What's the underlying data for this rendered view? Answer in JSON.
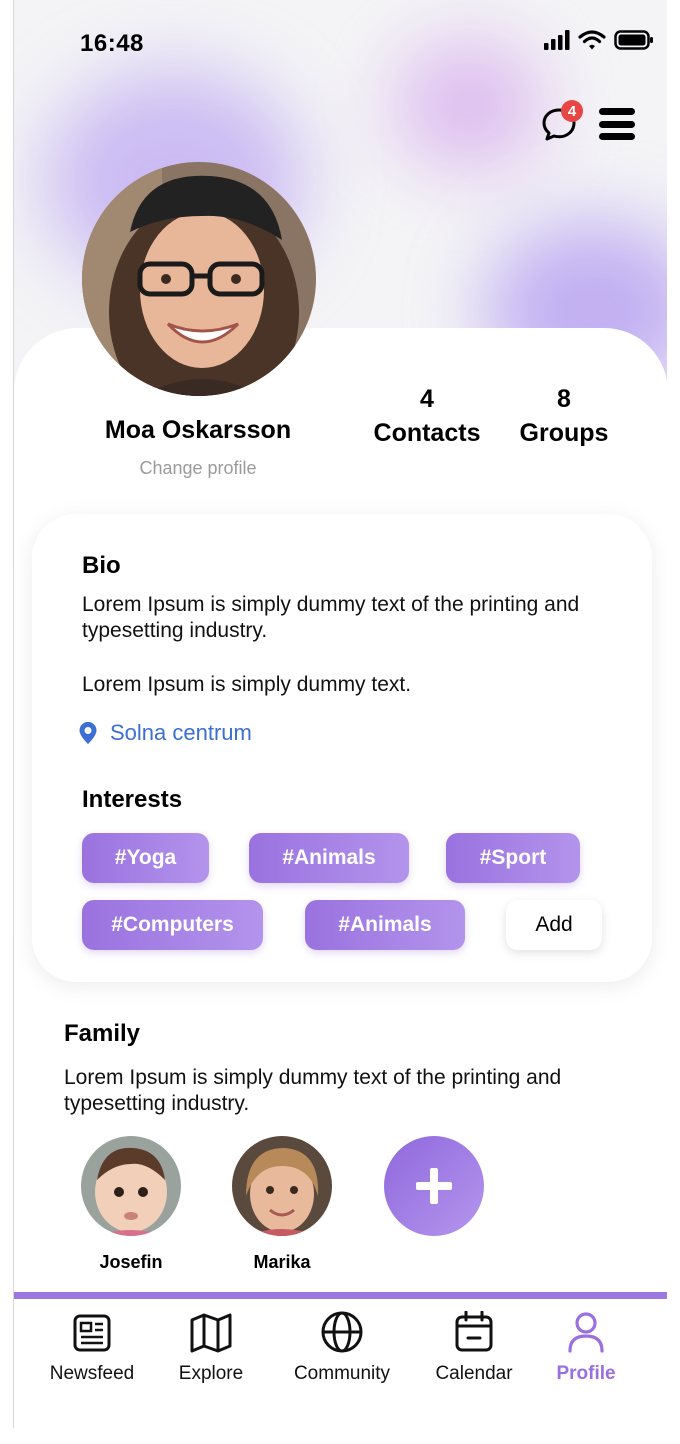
{
  "status_bar": {
    "time": "16:48"
  },
  "header": {
    "notification_count": "4"
  },
  "profile": {
    "name": "Moa Oskarsson",
    "change_profile_label": "Change profile",
    "contacts_count": "4",
    "contacts_label": "Contacts",
    "groups_count": "8",
    "groups_label": "Groups"
  },
  "bio": {
    "title": "Bio",
    "text1": "Lorem Ipsum is simply dummy text of the printing and typesetting industry.",
    "text2": "Lorem Ipsum is simply dummy text.",
    "location": "Solna centrum"
  },
  "interests": {
    "title": "Interests",
    "tags": [
      "#Yoga",
      "#Animals",
      "#Sport",
      "#Computers",
      "#Animals"
    ],
    "add_label": "Add"
  },
  "family": {
    "title": "Family",
    "text": "Lorem Ipsum is simply dummy text of the printing and typesetting industry.",
    "members": [
      {
        "name": "Josefin"
      },
      {
        "name": "Marika"
      }
    ]
  },
  "nav": {
    "items": [
      {
        "label": "Newsfeed",
        "icon": "newspaper-icon"
      },
      {
        "label": "Explore",
        "icon": "map-icon"
      },
      {
        "label": "Community",
        "icon": "globe-icon"
      },
      {
        "label": "Calendar",
        "icon": "calendar-icon"
      },
      {
        "label": "Profile",
        "icon": "user-icon"
      }
    ],
    "active": "Profile"
  },
  "colors": {
    "accent": "#9a6fdf",
    "link": "#3b6fd1",
    "badge": "#e84545"
  }
}
